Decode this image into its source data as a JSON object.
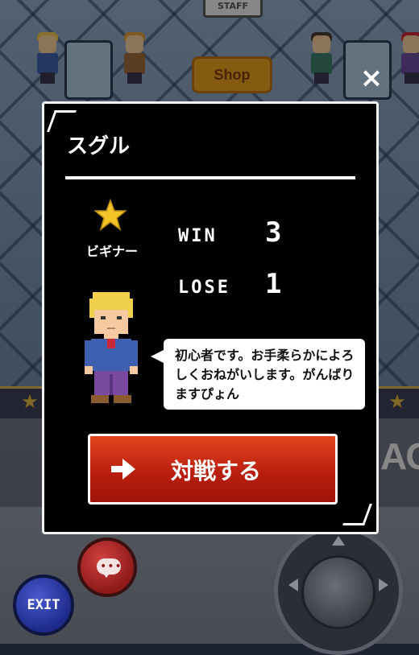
{
  "background": {
    "staff_sign": "STAFF",
    "shop_sign": "Shop",
    "side_text": "AG"
  },
  "controls": {
    "close_icon": "×",
    "exit_label": "EXIT",
    "chat_icon": "speech-bubble-icon"
  },
  "dialog": {
    "player_name": "スグル",
    "rank": {
      "icon": "star-icon",
      "label": "ビギナー"
    },
    "stats": {
      "win_label": "WIN",
      "win_value": "3",
      "lose_label": "LOSE",
      "lose_value": "1"
    },
    "message": "初心者です。お手柔らかによろしくおねがいします。がんばりますぴょん",
    "fight_button": {
      "label": "対戦する",
      "icon": "arrow-right-icon"
    }
  },
  "colors": {
    "dialog_bg": "#000000",
    "fight_button": "#c8290f",
    "star": "#f2c428",
    "exit_button": "#2a3aa8",
    "chat_button": "#b42626"
  }
}
